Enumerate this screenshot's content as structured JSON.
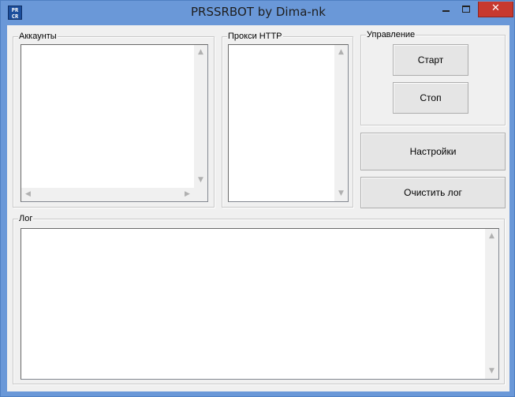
{
  "window": {
    "title": "PRSSRBOT by Dima-nk",
    "icon_text_top": "PR",
    "icon_text_bottom": "CR"
  },
  "titlebar_controls": {
    "close_glyph": "✕"
  },
  "groups": {
    "accounts": {
      "label": "Аккаунты"
    },
    "proxies": {
      "label": "Прокси HTTP"
    },
    "control": {
      "label": "Управление"
    },
    "log": {
      "label": "Лог"
    }
  },
  "buttons": {
    "start": "Старт",
    "stop": "Стоп",
    "settings": "Настройки",
    "clear_log": "Очистить лог"
  },
  "colors": {
    "frame": "#6a98d8",
    "client": "#f0f0f0",
    "close": "#c7392f"
  }
}
